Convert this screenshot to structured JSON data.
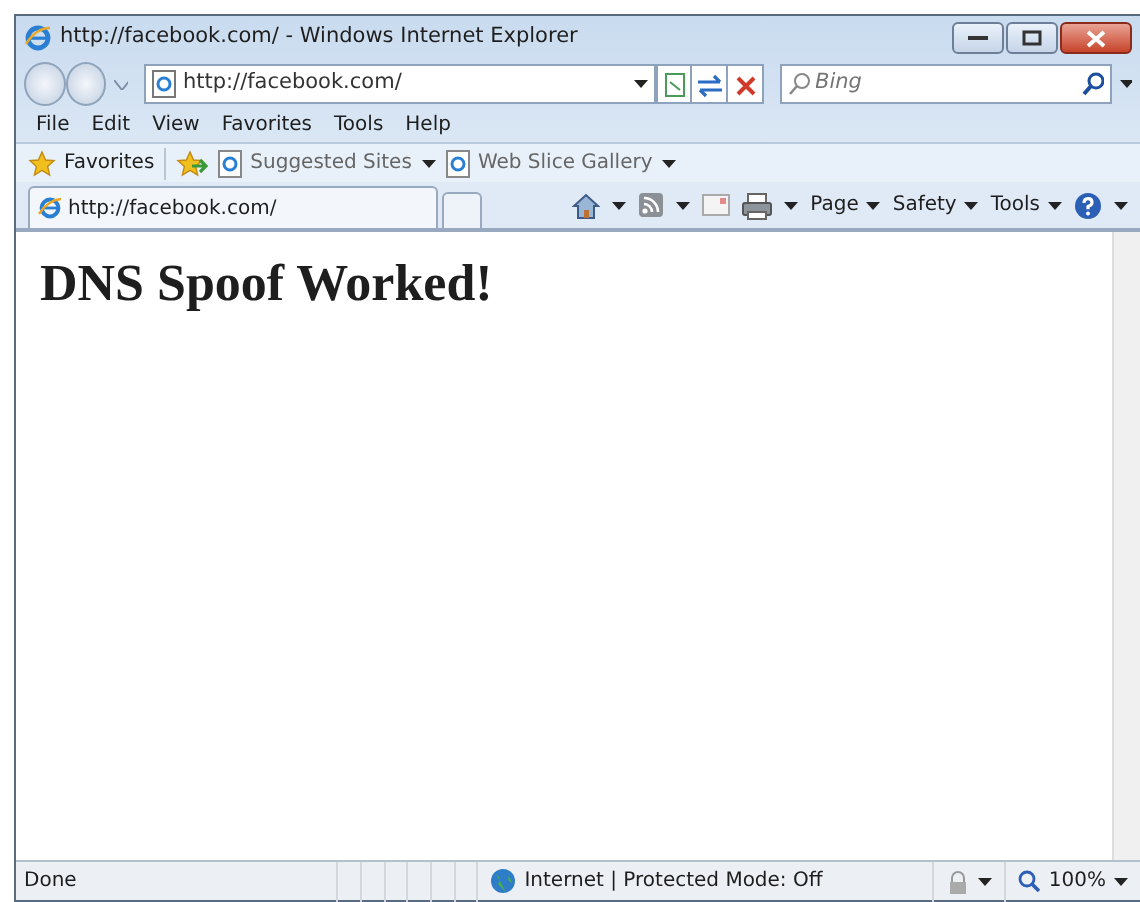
{
  "window": {
    "title": "http://facebook.com/ - Windows Internet Explorer"
  },
  "address_bar": {
    "value": "http://facebook.com/"
  },
  "search": {
    "placeholder": "Bing"
  },
  "menu": [
    "File",
    "Edit",
    "View",
    "Favorites",
    "Tools",
    "Help"
  ],
  "favorites_bar": {
    "favorites": "Favorites",
    "links": [
      "Suggested Sites",
      "Web Slice Gallery"
    ]
  },
  "tabs": [
    {
      "label": "http://facebook.com/",
      "selected": true
    }
  ],
  "command_bar": [
    "Page",
    "Safety",
    "Tools"
  ],
  "page": {
    "heading": "DNS Spoof Worked!"
  },
  "status_bar": {
    "status": "Done",
    "zone": "Internet | Protected Mode: Off",
    "zoom": "100%"
  }
}
